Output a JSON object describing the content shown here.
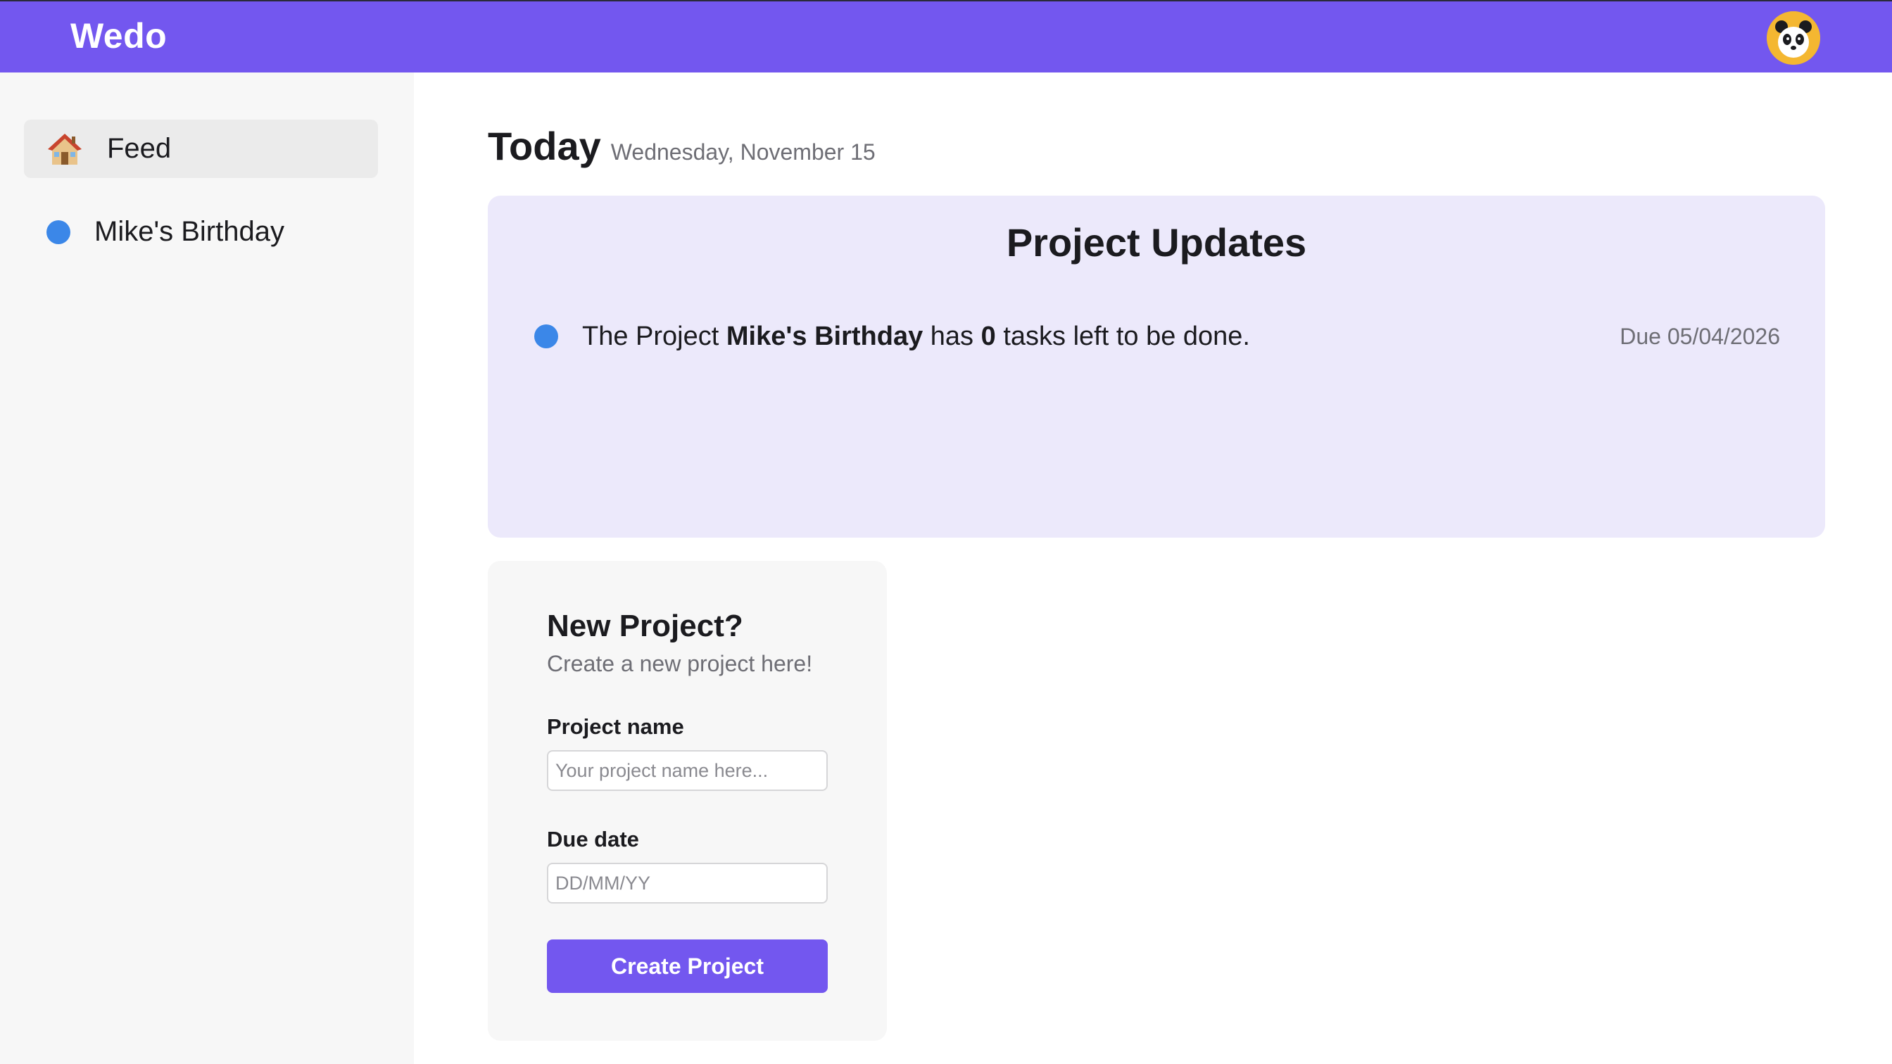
{
  "header": {
    "brand": "Wedo",
    "avatar_icon": "panda-avatar-icon",
    "bg_color": "#7357ef"
  },
  "sidebar": {
    "items": [
      {
        "label": "Feed",
        "icon": "house-icon",
        "active": true
      },
      {
        "label": "Mike's Birthday",
        "icon": "blue-dot-icon",
        "color": "#3b87e8",
        "active": false
      }
    ]
  },
  "main": {
    "today_title": "Today",
    "today_date": "Wednesday, November 15",
    "updates": {
      "title": "Project Updates",
      "items": [
        {
          "prefix": "The Project",
          "project": "Mike's Birthday",
          "middle": "has",
          "count": "0",
          "suffix": "tasks left to be done.",
          "due": "Due 05/04/2026",
          "color": "#3b87e8"
        }
      ]
    },
    "new_project": {
      "title": "New Project?",
      "subtitle": "Create a new project here!",
      "name_label": "Project name",
      "name_placeholder": "Your project name here...",
      "date_label": "Due date",
      "date_placeholder": "DD/MM/YY",
      "button_label": "Create Project"
    }
  }
}
